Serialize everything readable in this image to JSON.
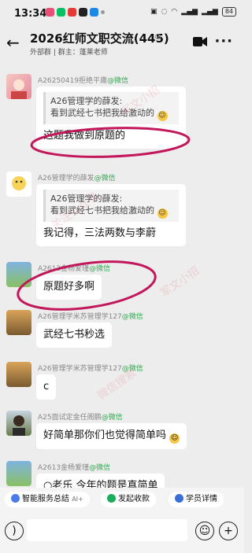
{
  "status": {
    "time": "13:34",
    "battery": "84"
  },
  "header": {
    "title": "2026红师文职交流(445)",
    "subtitle": "外部群 | 群主：蓬莱老师"
  },
  "messages": [
    {
      "sender": "A26250419拒绝平庸",
      "source": "@微信",
      "quote": "A26管理学的薛发:\n看到武经七书把我给激动的",
      "text": "这题我做到原题的"
    },
    {
      "sender": "A26管理学的薛发",
      "source": "@微信",
      "quote": "A26管理学的薛发:\n看到武经七书把我给激动的",
      "text": "我记得，三法两数与李蔚"
    },
    {
      "sender": "A2613金杨爱瑾",
      "source": "@微信",
      "text": "原题好多啊"
    },
    {
      "sender": "A26管理学米苏管理学127",
      "source": "@微信",
      "text": "武经七书秒选"
    },
    {
      "sender": "A26管理学米苏管理学127",
      "source": "@微信",
      "text": "c"
    },
    {
      "sender": "A25面试定金任阁鹏",
      "source": "@微信",
      "text": "好简单那你们也觉得简单吗"
    },
    {
      "sender": "A2613金杨爱瑾",
      "source": "@微信",
      "text": "○老乐 今年的题是真简单"
    }
  ],
  "watermarks": [
    "军文小招",
    "关注公众号",
    "微信搜索"
  ],
  "quick_actions": [
    "智能服务总结",
    "发起收款",
    "学员详情"
  ],
  "quick_action_ai": "AI",
  "colors": {
    "accent_green": "#34a853",
    "annotation": "#c2185b"
  }
}
